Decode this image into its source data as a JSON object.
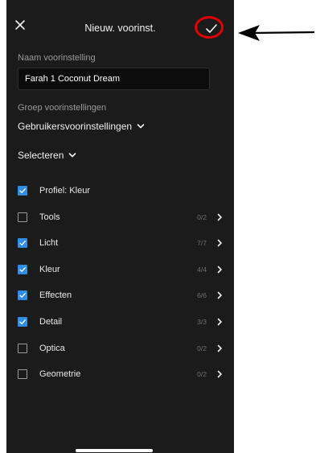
{
  "header": {
    "title": "Nieuw. voorinst.",
    "close_icon": "close-icon",
    "confirm_icon": "checkmark-icon"
  },
  "name_field": {
    "label": "Naam voorinstelling",
    "value": "Farah 1 Coconut Dream"
  },
  "group": {
    "label": "Groep voorinstellingen",
    "selected": "Gebruikersvoorinstellingen"
  },
  "select_menu": {
    "label": "Selecteren"
  },
  "settings": [
    {
      "label": "Profiel: Kleur",
      "checked": true,
      "count": "",
      "has_chevron": false
    },
    {
      "label": "Tools",
      "checked": false,
      "count": "0/2",
      "has_chevron": true
    },
    {
      "label": "Licht",
      "checked": true,
      "count": "7/7",
      "has_chevron": true
    },
    {
      "label": "Kleur",
      "checked": true,
      "count": "4/4",
      "has_chevron": true
    },
    {
      "label": "Effecten",
      "checked": true,
      "count": "6/6",
      "has_chevron": true
    },
    {
      "label": "Detail",
      "checked": true,
      "count": "3/3",
      "has_chevron": true
    },
    {
      "label": "Optica",
      "checked": false,
      "count": "0/2",
      "has_chevron": true
    },
    {
      "label": "Geometrie",
      "checked": false,
      "count": "0/2",
      "has_chevron": true
    }
  ],
  "colors": {
    "background": "#1b1b1b",
    "checkbox_checked": "#2f8de4",
    "annotation_ring": "#e10000",
    "annotation_arrow": "#000000"
  }
}
